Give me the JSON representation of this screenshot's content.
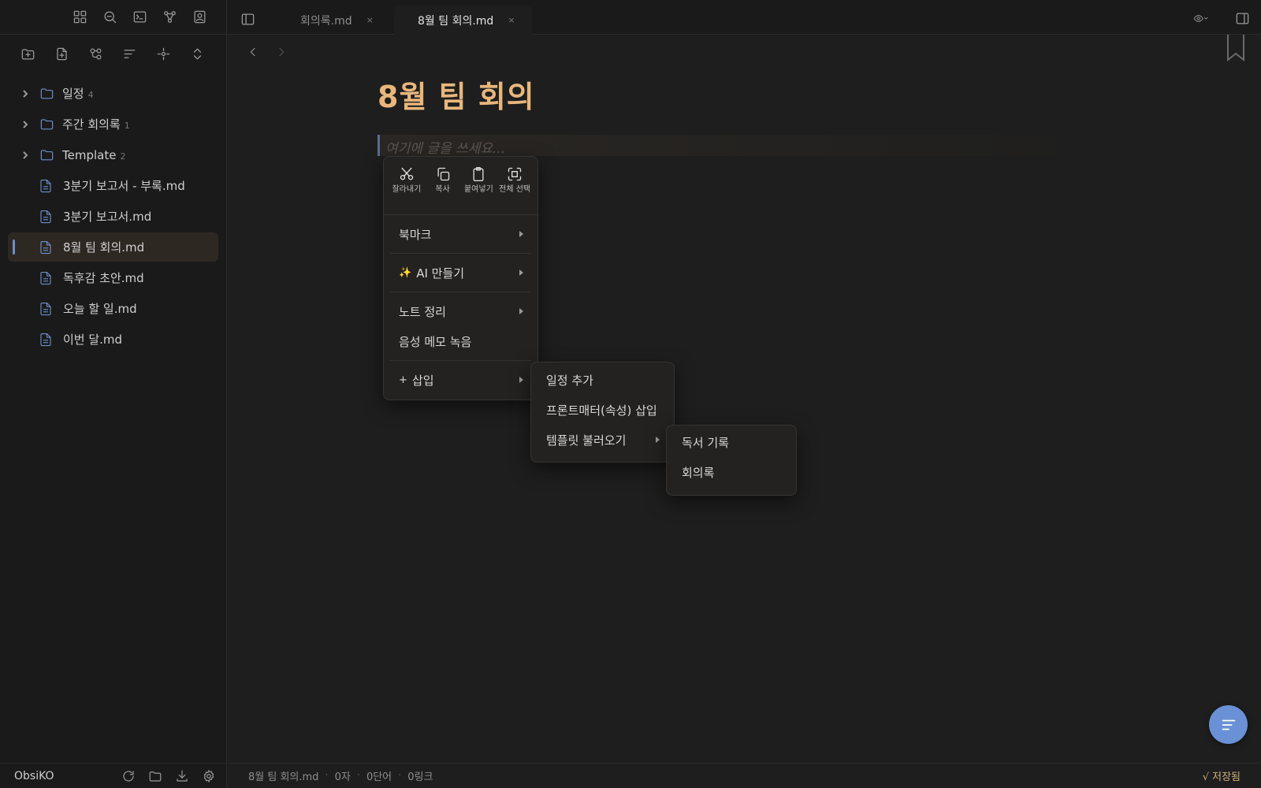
{
  "sidebar": {
    "tree": [
      {
        "type": "folder",
        "label": "일정",
        "count": "4"
      },
      {
        "type": "folder",
        "label": "주간 회의록",
        "count": "1"
      },
      {
        "type": "folder",
        "label": "Template",
        "count": "2"
      },
      {
        "type": "file",
        "label": "3분기 보고서 - 부록.md"
      },
      {
        "type": "file",
        "label": "3분기 보고서.md"
      },
      {
        "type": "file",
        "label": "8월 팀 회의.md",
        "active": true
      },
      {
        "type": "file",
        "label": "독후감 초안.md"
      },
      {
        "type": "file",
        "label": "오늘 할 일.md"
      },
      {
        "type": "file",
        "label": "이번 달.md"
      }
    ],
    "vault_name": "ObsiKO"
  },
  "tabs": [
    {
      "label": "회의록.md",
      "close": "×"
    },
    {
      "label": "8월 팀 회의.md",
      "close": "×",
      "active": true
    }
  ],
  "editor": {
    "title": "8월 팀 회의",
    "placeholder": "여기에 글을 쓰세요..."
  },
  "context_menu": {
    "quick_actions": [
      {
        "label": "잘라내기",
        "icon": "scissors-icon"
      },
      {
        "label": "복사",
        "icon": "copy-icon"
      },
      {
        "label": "붙여넣기",
        "icon": "paste-icon"
      },
      {
        "label": "전체 선택",
        "icon": "select-all-icon"
      }
    ],
    "items": {
      "bookmark": "북마크",
      "ai_prefix": "✨",
      "ai": "AI 만들기",
      "organize": "노트 정리",
      "voice_memo": "음성 메모 녹음",
      "insert_prefix": "+",
      "insert": "삽입"
    }
  },
  "insert_submenu": {
    "add_schedule": "일정 추가",
    "frontmatter": "프론트매터(속성) 삽입",
    "load_template": "템플릿 불러오기"
  },
  "template_submenu": {
    "reading_log": "독서 기록",
    "meeting_notes": "회의록"
  },
  "statusbar": {
    "filename": "8월 팀 회의.md",
    "chars": "0자",
    "words": "0단어",
    "links": "0링크",
    "separator": "·",
    "saved": "√ 저장됨"
  },
  "colors": {
    "accent": "#6a91d6",
    "title": "#e8b77c",
    "background": "#1e1e1e"
  }
}
